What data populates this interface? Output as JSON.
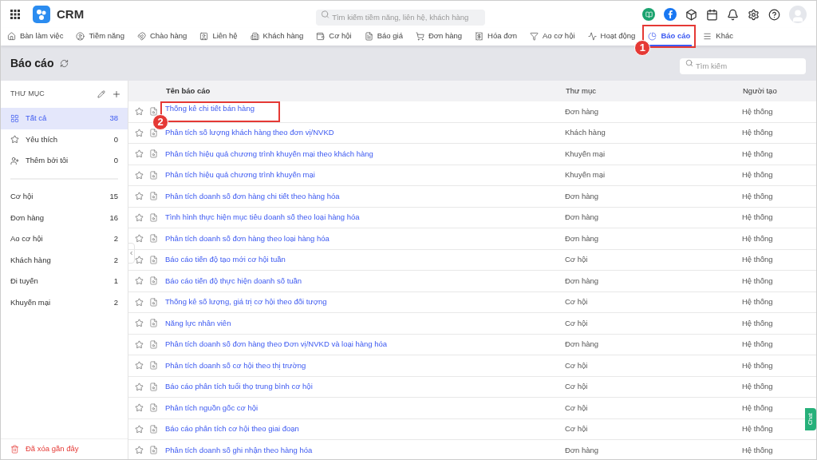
{
  "app": {
    "name": "CRM",
    "search_placeholder": "Tìm kiếm tiềm năng, liên hệ, khách hàng"
  },
  "nav": [
    {
      "label": "Bàn làm việc",
      "selected": false
    },
    {
      "label": "Tiềm năng",
      "selected": false
    },
    {
      "label": "Chào hàng",
      "selected": false
    },
    {
      "label": "Liên hệ",
      "selected": false
    },
    {
      "label": "Khách hàng",
      "selected": false
    },
    {
      "label": "Cơ hội",
      "selected": false
    },
    {
      "label": "Báo giá",
      "selected": false
    },
    {
      "label": "Đơn hàng",
      "selected": false
    },
    {
      "label": "Hóa đơn",
      "selected": false
    },
    {
      "label": "Ao cơ hội",
      "selected": false
    },
    {
      "label": "Hoạt động",
      "selected": false
    },
    {
      "label": "Báo cáo",
      "selected": true,
      "callout": "1"
    },
    {
      "label": "Khác",
      "selected": false
    }
  ],
  "page": {
    "title": "Báo cáo",
    "search_placeholder": "Tìm kiếm"
  },
  "sidebar": {
    "heading": "THƯ MỤC",
    "filters": [
      {
        "label": "Tất cả",
        "count": "38",
        "selected": true
      },
      {
        "label": "Yêu thích",
        "count": "0",
        "selected": false
      },
      {
        "label": "Thêm bởi tôi",
        "count": "0",
        "selected": false
      }
    ],
    "folders": [
      {
        "label": "Cơ hội",
        "count": "15"
      },
      {
        "label": "Đơn hàng",
        "count": "16"
      },
      {
        "label": "Ao cơ hội",
        "count": "2"
      },
      {
        "label": "Khách hàng",
        "count": "2"
      },
      {
        "label": "Đi tuyến",
        "count": "1"
      },
      {
        "label": "Khuyến mại",
        "count": "2"
      }
    ],
    "trash": "Đã xóa gần đây"
  },
  "table": {
    "columns": [
      "Tên báo cáo",
      "Thư mục",
      "Người tạo"
    ],
    "rows": [
      {
        "name": "Thống kê chi tiết bán hàng",
        "folder": "Đơn hàng",
        "creator": "Hệ thống",
        "callout": "2"
      },
      {
        "name": "Phân tích số lượng khách hàng theo đơn vị/NVKD",
        "folder": "Khách hàng",
        "creator": "Hệ thống"
      },
      {
        "name": "Phân tích hiệu quả chương trình khuyến mại theo khách hàng",
        "folder": "Khuyến mại",
        "creator": "Hệ thống"
      },
      {
        "name": "Phân tích hiệu quả chương trình khuyến mại",
        "folder": "Khuyến mại",
        "creator": "Hệ thống"
      },
      {
        "name": "Phân tích doanh số đơn hàng chi tiết theo hàng hóa",
        "folder": "Đơn hàng",
        "creator": "Hệ thống"
      },
      {
        "name": "Tình hình thực hiện mục tiêu doanh số theo loại hàng hóa",
        "folder": "Đơn hàng",
        "creator": "Hệ thống"
      },
      {
        "name": "Phân tích doanh số đơn hàng theo loại hàng hóa",
        "folder": "Đơn hàng",
        "creator": "Hệ thống"
      },
      {
        "name": "Báo cáo tiến độ tạo mới cơ hội tuần",
        "folder": "Cơ hội",
        "creator": "Hệ thống"
      },
      {
        "name": "Báo cáo tiến độ thực hiện doanh số tuần",
        "folder": "Đơn hàng",
        "creator": "Hệ thống"
      },
      {
        "name": "Thống kê số lượng, giá trị cơ hội theo đối tượng",
        "folder": "Cơ hội",
        "creator": "Hệ thống"
      },
      {
        "name": "Năng lực nhân viên",
        "folder": "Cơ hội",
        "creator": "Hệ thống"
      },
      {
        "name": "Phân tích doanh số đơn hàng theo Đơn vị/NVKD và loại hàng hóa",
        "folder": "Đơn hàng",
        "creator": "Hệ thống"
      },
      {
        "name": "Phân tích doanh số cơ hội theo thị trường",
        "folder": "Cơ hội",
        "creator": "Hệ thống"
      },
      {
        "name": "Báo cáo phân tích tuổi thọ trung bình cơ hội",
        "folder": "Cơ hội",
        "creator": "Hệ thống"
      },
      {
        "name": "Phân tích nguồn gốc cơ hội",
        "folder": "Cơ hội",
        "creator": "Hệ thống"
      },
      {
        "name": "Báo cáo phân tích cơ hội theo giai đoạn",
        "folder": "Cơ hội",
        "creator": "Hệ thống"
      },
      {
        "name": "Phân tích doanh số ghi nhận theo hàng hóa",
        "folder": "Đơn hàng",
        "creator": "Hệ thống"
      }
    ]
  },
  "chat_button": "Chat"
}
